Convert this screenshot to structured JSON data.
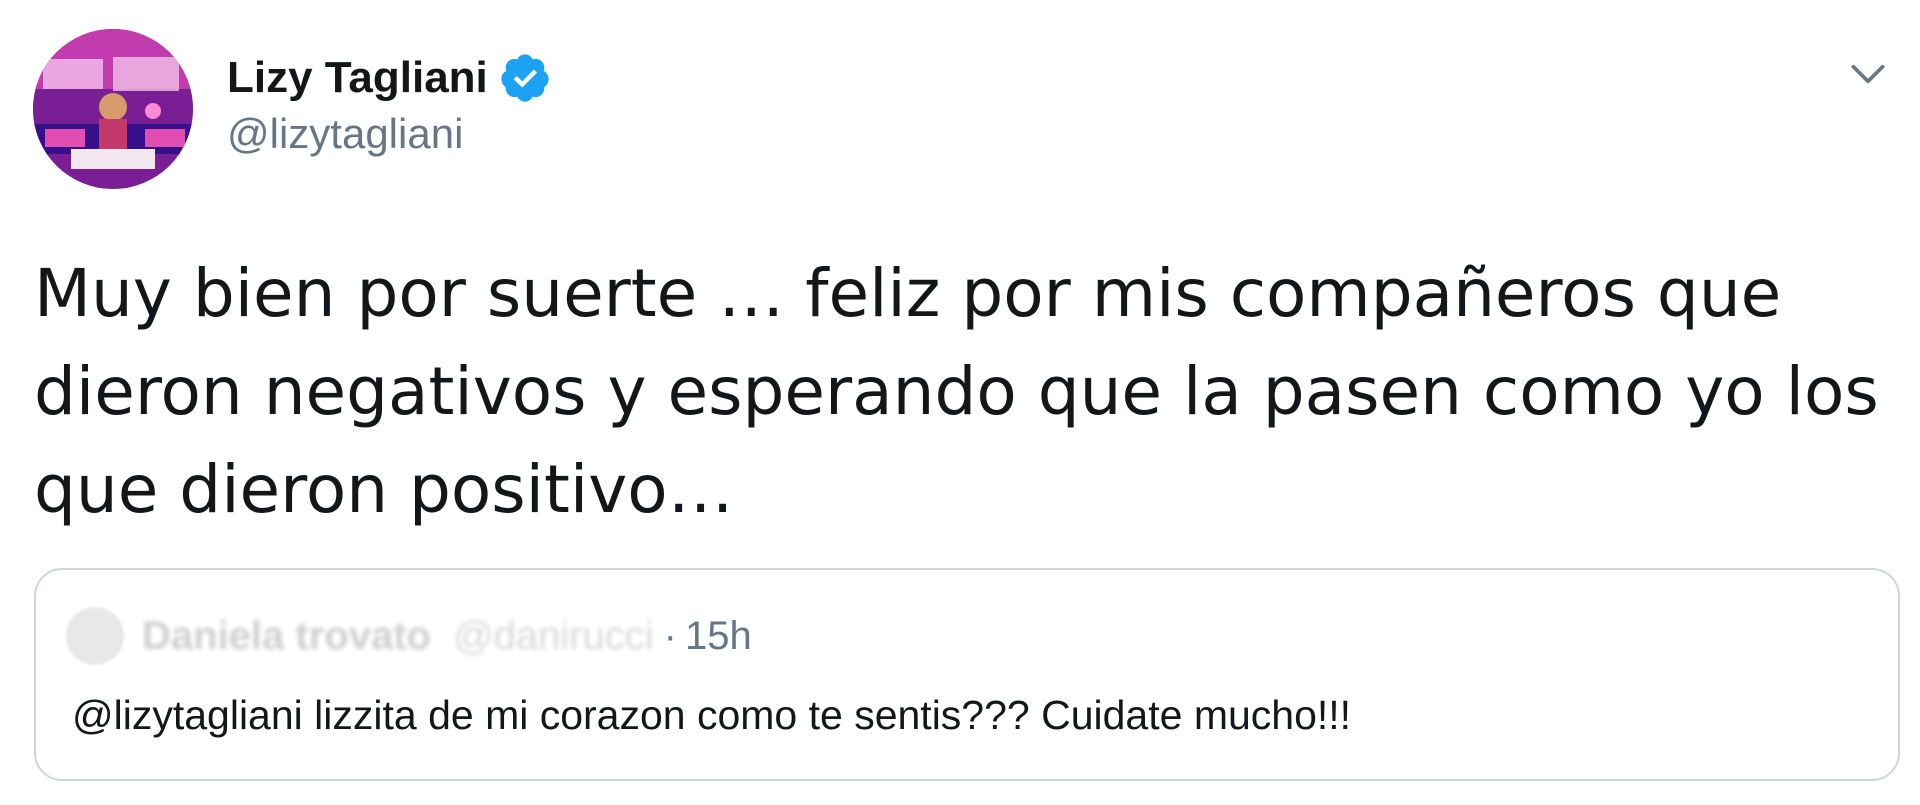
{
  "author": {
    "display_name": "Lizy Tagliani",
    "handle": "@lizytagliani",
    "avatar_icon": "profile-photo",
    "verified_icon": "verified-badge-icon",
    "verified_color": "#1da1f2"
  },
  "menu": {
    "icon": "chevron-down-icon"
  },
  "tweet": {
    "lines": [
      "Muy bien por suerte … feliz por mis compañeros que",
      "dieron negativos y esperando que la pasen como yo los",
      "que dieron positivo…"
    ]
  },
  "quote": {
    "display_name": "Daniela trovato",
    "handle": "@danirucci",
    "separator": "·",
    "time": "15h",
    "text": "@lizytagliani lizzita de mi corazon como te sentis??? Cuidate mucho!!!"
  },
  "colors": {
    "text_primary": "#14171a",
    "text_secondary": "#657786",
    "border": "#ccd6dd",
    "accent": "#1da1f2"
  }
}
